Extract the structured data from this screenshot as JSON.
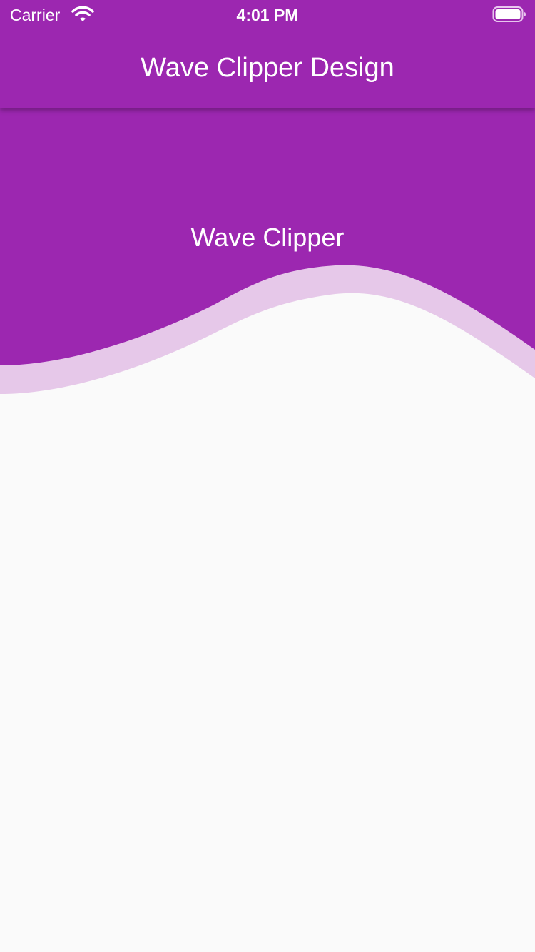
{
  "status_bar": {
    "carrier": "Carrier",
    "time": "4:01 PM",
    "icons": [
      "wifi-icon",
      "battery-icon"
    ]
  },
  "app_bar": {
    "title": "Wave Clipper Design"
  },
  "header": {
    "title": "Wave Clipper"
  },
  "colors": {
    "primary": "#9c27b0",
    "wave_light": "#e6c8e9",
    "background": "#fafafa",
    "text_on_primary": "#ffffff"
  }
}
